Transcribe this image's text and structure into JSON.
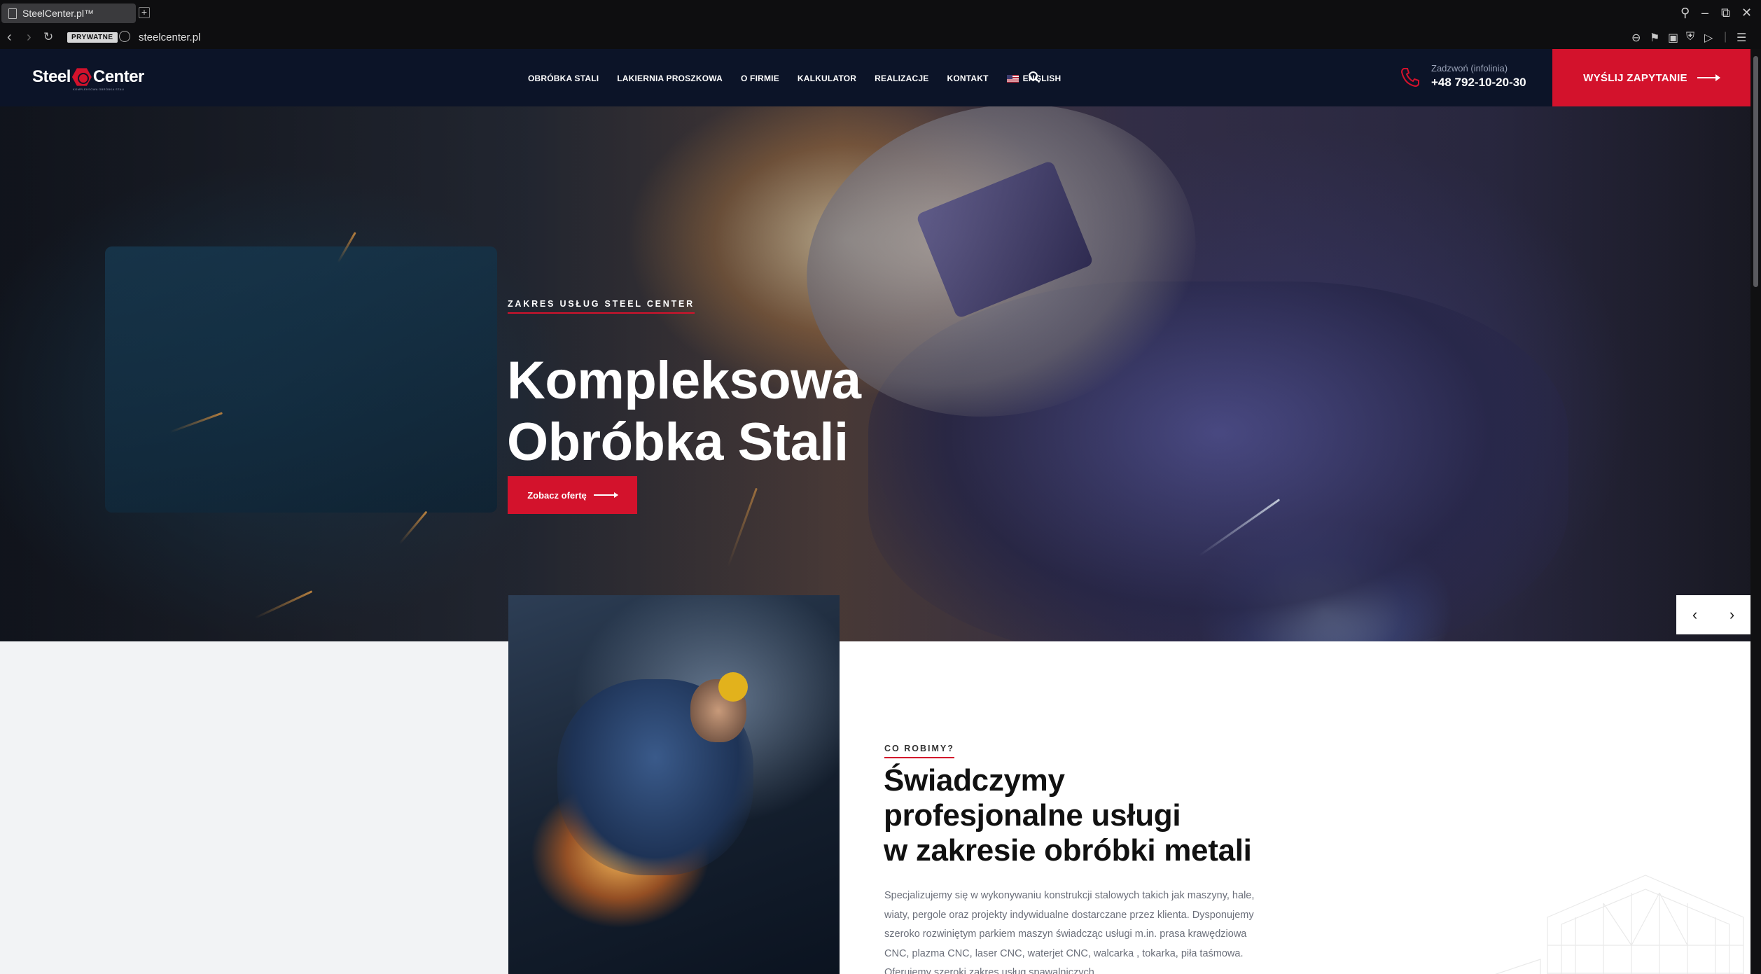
{
  "browser": {
    "tab_title": "SteelCenter.pl™",
    "new_tab": "+",
    "private_badge": "PRYWATNE",
    "url": "steelcenter.pl",
    "window_controls": [
      "search-icon",
      "minimize-icon",
      "restore-icon",
      "close-icon"
    ]
  },
  "header": {
    "logo_left": "Steel",
    "logo_right": "Center",
    "logo_tagline": "KOMPLEKSOWA OBRÓBKA STALI",
    "menu": [
      {
        "label": "OBRÓBKA STALI"
      },
      {
        "label": "LAKIERNIA PROSZKOWA"
      },
      {
        "label": "O FIRMIE"
      },
      {
        "label": "KALKULATOR"
      },
      {
        "label": "REALIZACJE"
      },
      {
        "label": "KONTAKT"
      },
      {
        "label": "ENGLISH"
      }
    ],
    "phone_label": "Zadzwoń (infolinia)",
    "phone_number": "+48 792-10-20-30",
    "cta_label": "WYŚLIJ ZAPYTANIE"
  },
  "hero": {
    "eyebrow": "ZAKRES USŁUG STEEL CENTER",
    "title_line1": "Kompleksowa",
    "title_line2": "Obróbka Stali",
    "button_label": "Zobacz ofertę",
    "prev": "‹",
    "next": "›"
  },
  "about": {
    "eyebrow": "CO ROBIMY?",
    "title_line1": "Świadczymy",
    "title_line2": "profesjonalne usługi",
    "title_line3": "w zakresie obróbki metali",
    "paragraph": "Specjalizujemy się w wykonywaniu konstrukcji stalowych takich jak maszyny, hale, wiaty, pergole oraz projekty indywidualne dostarczane przez klienta. Dysponujemy szeroko rozwiniętym parkiem maszyn świadcząc usługi m.in. prasa krawędziowa CNC, plazma CNC, laser CNC, waterjet CNC, walcarka , tokarka, piła taśmowa. Oferujemy szeroki zakres usług spawalniczych."
  },
  "colors": {
    "brand_red": "#d3122c",
    "navy": "#0c1428"
  }
}
